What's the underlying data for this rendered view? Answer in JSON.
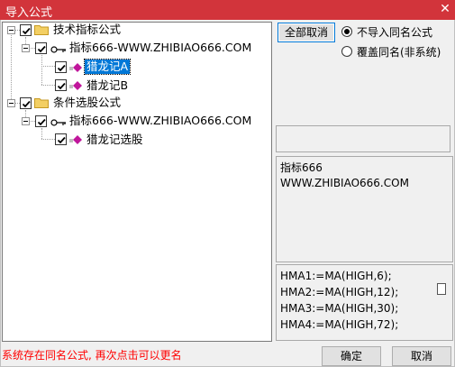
{
  "window": {
    "title": "导入公式",
    "close_glyph": "✕"
  },
  "tree": {
    "nodes": [
      {
        "label": "技术指标公式",
        "checked": true,
        "icon": "folder-icon",
        "expanded": true
      },
      {
        "label": "指标666-WWW.ZHIBIAO666.COM",
        "checked": true,
        "icon": "key-icon",
        "expanded": true
      },
      {
        "label": "猎龙记A",
        "checked": true,
        "icon": "formula-diamond-icon",
        "selected": true
      },
      {
        "label": "猎龙记B",
        "checked": true,
        "icon": "formula-diamond-icon"
      },
      {
        "label": "条件选股公式",
        "checked": true,
        "icon": "folder-icon",
        "expanded": true
      },
      {
        "label": "指标666-WWW.ZHIBIAO666.COM",
        "checked": true,
        "icon": "key-icon",
        "expanded": true
      },
      {
        "label": "猎龙记选股",
        "checked": true,
        "icon": "formula-diamond-icon"
      }
    ]
  },
  "options": {
    "deselect_all_label": "全部取消",
    "radio_skip_label": "不导入同名公式",
    "radio_overwrite_label": "覆盖同名(非系统)",
    "selected": "skip"
  },
  "info": {
    "line1": "指标666",
    "line2": "WWW.ZHIBIAO666.COM"
  },
  "code": {
    "lines": [
      "HMA1:=MA(HIGH,6);",
      "HMA2:=MA(HIGH,12);",
      "HMA3:=MA(HIGH,30);",
      "HMA4:=MA(HIGH,72);"
    ]
  },
  "footer": {
    "status": "系统存在同名公式, 再次点击可以更名",
    "ok_label": "确定",
    "cancel_label": "取消"
  },
  "colors": {
    "titlebar": "#d2343b",
    "selection": "#0078d7",
    "status_text": "#ff0000",
    "folder": "#f3cf63",
    "diamond": "#c0169b"
  }
}
